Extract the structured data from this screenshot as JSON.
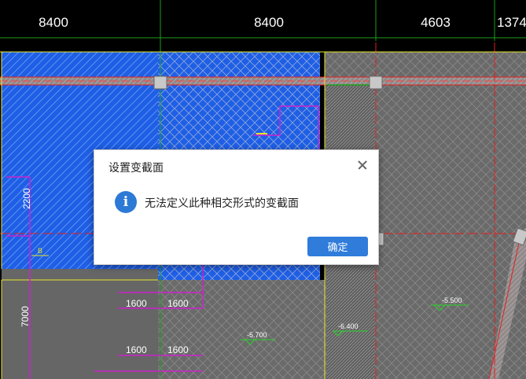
{
  "ruler": {
    "dimensions": [
      "8400",
      "8400",
      "4603",
      "1374"
    ]
  },
  "drawing": {
    "labels": {
      "dim_2200": "2200",
      "dim_7000": "7000",
      "dim_1600_a": "1600",
      "dim_1600_b": "1600",
      "dim_1600_c": "1600",
      "dim_1600_d": "1600",
      "elev_5700": "-5.700",
      "elev_6400": "-6.400",
      "elev_5500": "-5.500",
      "mark_b": "B"
    }
  },
  "dialog": {
    "title": "设置变截面",
    "message": "无法定义此种相交形式的变截面",
    "ok_label": "确定",
    "icon": "info-icon"
  },
  "colors": {
    "slab_blue": "#1e5fe6",
    "slab_gray": "#6a6a6a",
    "axis_red": "#e02020",
    "grid_green": "#1aa01a",
    "line_magenta": "#cc22cc",
    "line_yellow": "#e6e62a",
    "accent_button": "#2f7cdb"
  }
}
